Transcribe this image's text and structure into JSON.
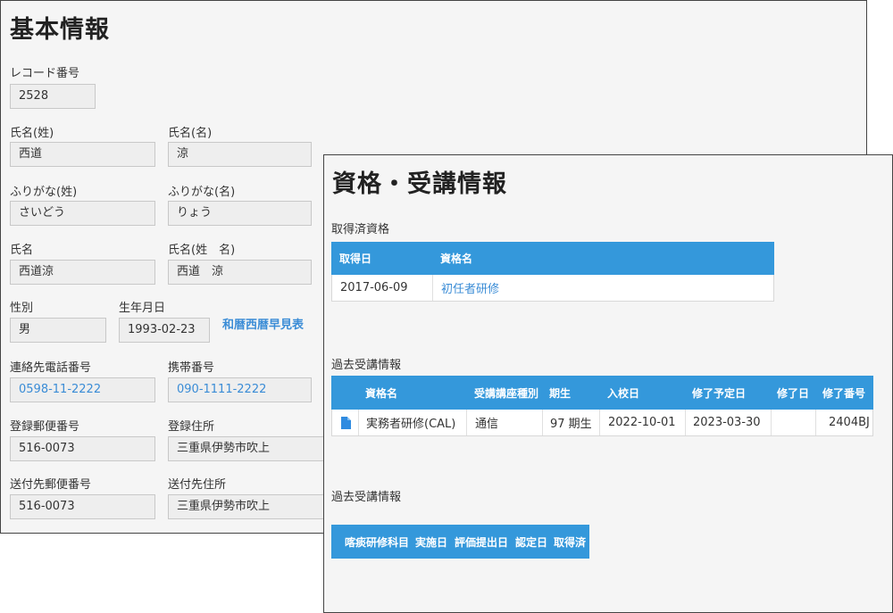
{
  "basic": {
    "title": "基本情報",
    "record_no": {
      "label": "レコード番号",
      "value": "2528"
    },
    "last_name": {
      "label": "氏名(姓)",
      "value": "西道"
    },
    "first_name": {
      "label": "氏名(名)",
      "value": "涼"
    },
    "last_kana": {
      "label": "ふりがな(姓)",
      "value": "さいどう"
    },
    "first_kana": {
      "label": "ふりがな(名)",
      "value": "りょう"
    },
    "full_name": {
      "label": "氏名",
      "value": "西道涼"
    },
    "full_name_spaced": {
      "label": "氏名(姓　名)",
      "value": "西道　涼"
    },
    "gender": {
      "label": "性別",
      "value": "男"
    },
    "birthdate": {
      "label": "生年月日",
      "value": "1993-02-23"
    },
    "calendar_link": "和暦西暦早見表",
    "phone": {
      "label": "連絡先電話番号",
      "value": "0598-11-2222"
    },
    "mobile": {
      "label": "携帯番号",
      "value": "090-1111-2222"
    },
    "postal": {
      "label": "登録郵便番号",
      "value": "516-0073"
    },
    "address": {
      "label": "登録住所",
      "value": "三重県伊勢市吹上"
    },
    "send_postal": {
      "label": "送付先郵便番号",
      "value": "516-0073"
    },
    "send_address": {
      "label": "送付先住所",
      "value": "三重県伊勢市吹上"
    }
  },
  "qual": {
    "title": "資格・受講情報",
    "acquired": {
      "label": "取得済資格",
      "headers": [
        "取得日",
        "資格名"
      ],
      "rows": [
        {
          "date": "2017-06-09",
          "name": "初任者研修"
        }
      ]
    },
    "past1": {
      "label": "過去受講情報",
      "headers": [
        "資格名",
        "受講講座種別",
        "期生",
        "入校日",
        "修了予定日",
        "修了日",
        "修了番号"
      ],
      "row": {
        "icon": "document-icon",
        "name": "実務者研修(CAL)",
        "type": "通信",
        "term": "97 期生",
        "entry": "2022-10-01",
        "planned": "2023-03-30",
        "completed": "",
        "number": "2404BJ"
      }
    },
    "past2": {
      "label": "過去受講情報",
      "headers": [
        "喀痰研修科目",
        "実施日",
        "評価提出日",
        "認定日",
        "取得済"
      ]
    }
  },
  "colors": {
    "header_blue": "#3498db",
    "link_blue": "#3a8cd6",
    "panel_bg": "#f5f5f5"
  }
}
